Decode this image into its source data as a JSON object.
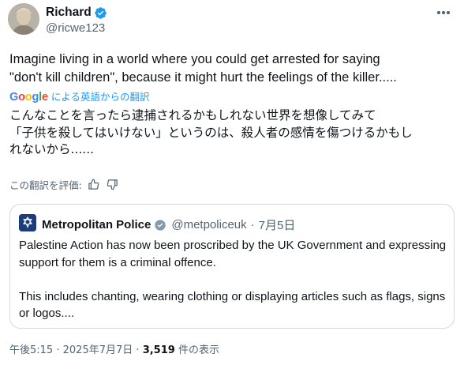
{
  "author": {
    "display_name": "Richard",
    "handle": "@ricwe123"
  },
  "tweet": {
    "text": "Imagine living in a world where you could get arrested for saying\n\"don't kill children\", because it might hurt the feelings of the killer....."
  },
  "translation": {
    "google_letters": [
      "G",
      "o",
      "o",
      "g",
      "l",
      "e"
    ],
    "label": "による英語からの翻訳",
    "text": "こんなことを言ったら逮捕されるかもしれない世界を想像してみて\n「子供を殺してはいけない」というのは、殺人者の感情を傷つけるかもし\nれないから......",
    "rate_label": "この翻訳を評価:"
  },
  "quote": {
    "display_name": "Metropolitan Police",
    "handle": "@metpoliceuk",
    "separator": "·",
    "date": "7月5日",
    "paragraph1": "Palestine Action has now been proscribed by the UK Government and expressing support for them is a criminal offence.",
    "paragraph2": "This includes chanting, wearing clothing or displaying articles such as flags, signs or logos...."
  },
  "meta": {
    "time": "午後5:15",
    "separator": "·",
    "date": "2025年7月7日",
    "views_count": "3,519",
    "views_label": "件の表示"
  },
  "colors": {
    "verified": "#1d9bf0",
    "link": "#1d9bf0",
    "secondary_text": "#536471",
    "border": "#cfd9de"
  },
  "icons": {
    "verified": "verified-badge-icon",
    "more": "more-options-icon",
    "thumbs_up": "thumbs-up-icon",
    "thumbs_down": "thumbs-down-icon"
  }
}
